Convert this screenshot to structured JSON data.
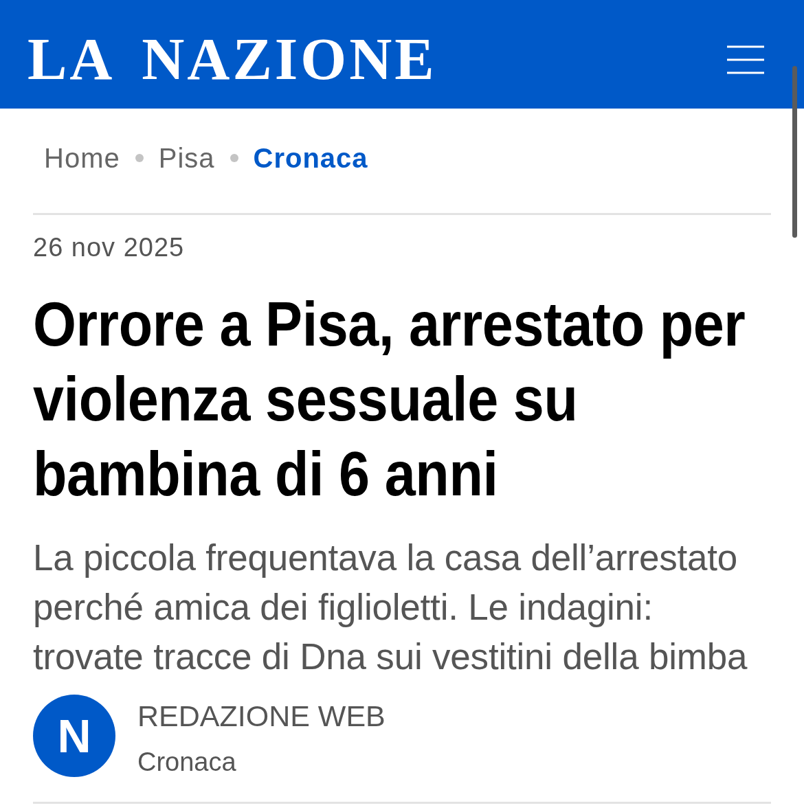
{
  "header": {
    "logo": "LA NAZIONE"
  },
  "breadcrumb": [
    {
      "label": "Home",
      "current": false
    },
    {
      "label": "Pisa",
      "current": false
    },
    {
      "label": "Cronaca",
      "current": true
    }
  ],
  "article": {
    "date": "26 nov 2025",
    "title": "Orrore a Pisa, arrestato per violenza sessuale su bambina di 6 anni",
    "subtitle": "La piccola frequentava la casa dell’arrestato perché amica dei figlioletti. Le indagini: trovate tracce di Dna sui vestitini della bimba",
    "author": {
      "initial": "N",
      "name": "REDAZIONE WEB",
      "section": "Cronaca"
    }
  }
}
